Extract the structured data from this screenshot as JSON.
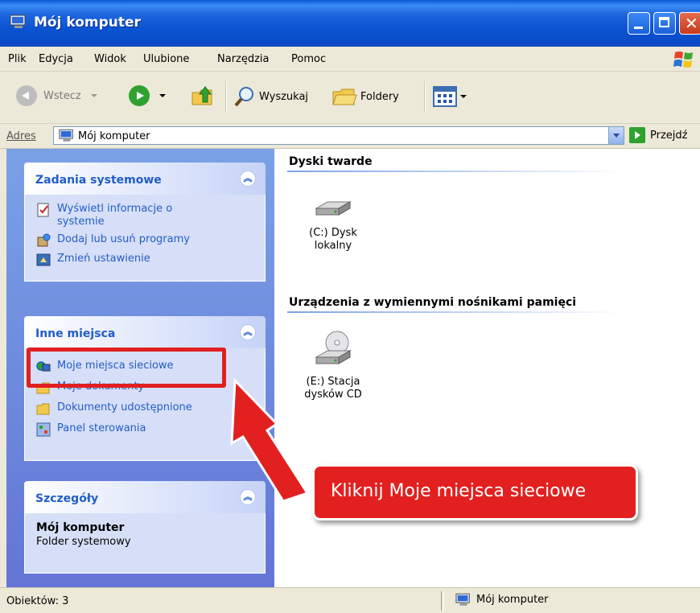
{
  "window": {
    "title": "Mój komputer"
  },
  "menu": [
    "Plik",
    "Edycja",
    "Widok",
    "Ulubione",
    "Narzędzia",
    "Pomoc"
  ],
  "toolbar": {
    "back": "Wstecz",
    "search": "Wyszukaj",
    "folders": "Foldery"
  },
  "address": {
    "label": "Adres",
    "value": "Mój komputer",
    "go": "Przejdź"
  },
  "tasks_panel": {
    "title": "Zadania systemowe",
    "items": [
      "Wyświetl informacje o systemie",
      "Dodaj lub usuń programy",
      "Zmień ustawienie"
    ]
  },
  "places_panel": {
    "title": "Inne miejsca",
    "items": [
      "Moje miejsca sieciowe",
      "Moje dokumenty",
      "Dokumenty udostępnione",
      "Panel sterowania"
    ]
  },
  "details_panel": {
    "title": "Szczegóły",
    "name": "Mój komputer",
    "type": "Folder systemowy"
  },
  "content": {
    "group1": "Dyski twarde",
    "drive_c": "(C:) Dysk lokalny",
    "group2": "Urządzenia z wymiennymi nośnikami pamięci",
    "drive_e": "(E:) Stacja dysków CD"
  },
  "status": {
    "count": "Obiektów: 3",
    "location": "Mój komputer"
  },
  "annotation": {
    "callout": "Kliknij Moje miejsca sieciowe"
  },
  "colors": {
    "accent_red": "#e22020",
    "link_blue": "#215dc6",
    "xp_blue": "#0b54d2"
  }
}
